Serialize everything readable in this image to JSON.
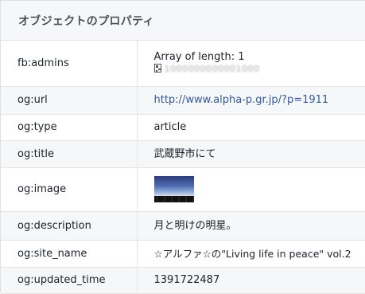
{
  "header": {
    "title": "オブジェクトのプロパティ"
  },
  "rows": [
    {
      "key": "fb:admins",
      "value_line1": "Array of length: 1",
      "value_line2": "1000000000001000",
      "icon": "qr-code-icon"
    },
    {
      "key": "og:url",
      "value": "http://www.alpha-p.gr.jp/?p=1911"
    },
    {
      "key": "og:type",
      "value": "article"
    },
    {
      "key": "og:title",
      "value": "武蔵野市にて"
    },
    {
      "key": "og:image",
      "image": "night-sky-silhouette-thumbnail"
    },
    {
      "key": "og:description",
      "value": "月と明けの明星。"
    },
    {
      "key": "og:site_name",
      "value": "☆アルファ☆の\"Living life in peace\" vol.2"
    },
    {
      "key": "og:updated_time",
      "value": "1391722487"
    }
  ],
  "colors": {
    "link": "#365899",
    "header_bg": "#f6f7f9",
    "alt_row_bg": "#f6f7f9"
  }
}
